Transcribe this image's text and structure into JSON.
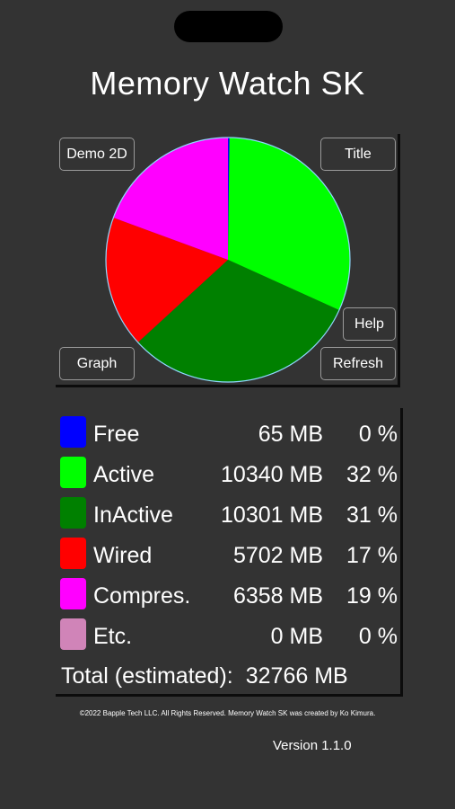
{
  "app": {
    "title": "Memory Watch SK"
  },
  "buttons": {
    "demo2d": "Demo 2D",
    "title": "Title",
    "help": "Help",
    "graph": "Graph",
    "refresh": "Refresh"
  },
  "chart_data": {
    "type": "pie",
    "title": "",
    "categories": [
      "Free",
      "Active",
      "InActive",
      "Wired",
      "Compres.",
      "Etc."
    ],
    "values": [
      65,
      10340,
      10301,
      5702,
      6358,
      0
    ],
    "units": "MB",
    "colors": [
      "#0000ff",
      "#00ff00",
      "#008000",
      "#ff0000",
      "#ff00ff",
      "#d084b8"
    ]
  },
  "legend": {
    "rows": [
      {
        "name": "Free",
        "mb": "65 MB",
        "pct": "0 %",
        "color": "#0000ff"
      },
      {
        "name": "Active",
        "mb": "10340 MB",
        "pct": "32 %",
        "color": "#00ff00"
      },
      {
        "name": "InActive",
        "mb": "10301 MB",
        "pct": "31 %",
        "color": "#008000"
      },
      {
        "name": "Wired",
        "mb": "5702 MB",
        "pct": "17 %",
        "color": "#ff0000"
      },
      {
        "name": "Compres.",
        "mb": "6358 MB",
        "pct": "19 %",
        "color": "#ff00ff"
      },
      {
        "name": "Etc.",
        "mb": "0 MB",
        "pct": "0 %",
        "color": "#d084b8"
      }
    ],
    "total_label": "Total (estimated):",
    "total_value": "32766 MB"
  },
  "footer": {
    "copyright": "©2022 Bapple Tech LLC. All Rights Reserved. Memory Watch SK was created by Ko Kimura.",
    "version": "Version 1.1.0"
  },
  "colors": {
    "background": "#333333",
    "panel_shadow": "#0c0c0c",
    "pie_outline": "#8fd8ff"
  }
}
